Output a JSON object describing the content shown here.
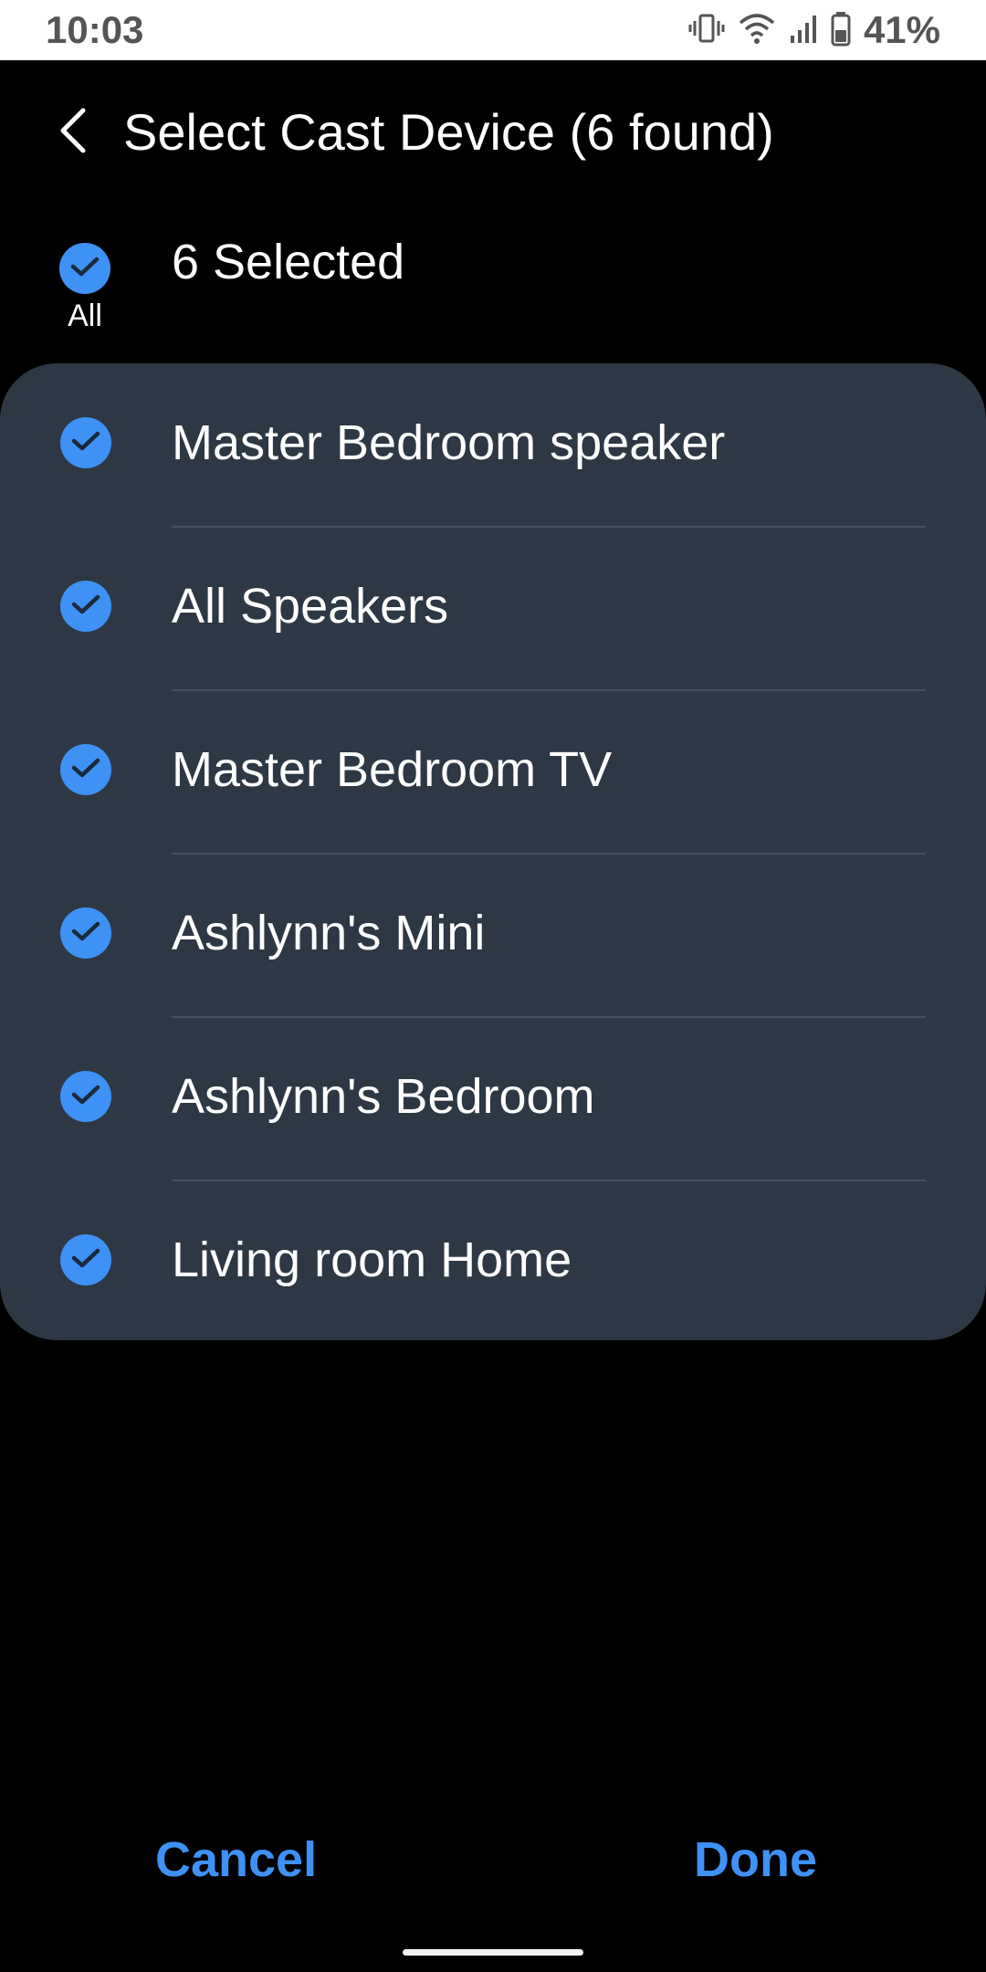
{
  "status_bar": {
    "time": "10:03",
    "battery_percent": "41%",
    "icons": [
      "vibrate-icon",
      "wifi-icon",
      "cell-signal-icon",
      "battery-icon"
    ]
  },
  "header": {
    "title": "Select Cast Device (6 found)",
    "back_icon": "chevron-left-icon"
  },
  "selection": {
    "all_label": "All",
    "count_text": "6 Selected",
    "all_checked": true
  },
  "devices": [
    {
      "name": "Master Bedroom speaker",
      "checked": true
    },
    {
      "name": "All Speakers",
      "checked": true
    },
    {
      "name": "Master Bedroom TV",
      "checked": true
    },
    {
      "name": "Ashlynn's Mini",
      "checked": true
    },
    {
      "name": "Ashlynn's Bedroom",
      "checked": true
    },
    {
      "name": "Living room Home",
      "checked": true
    }
  ],
  "footer": {
    "cancel_label": "Cancel",
    "done_label": "Done"
  },
  "colors": {
    "accent": "#3e91f5",
    "card_background": "#2d3844",
    "background": "#000000",
    "status_bar_background": "#ffffff"
  }
}
